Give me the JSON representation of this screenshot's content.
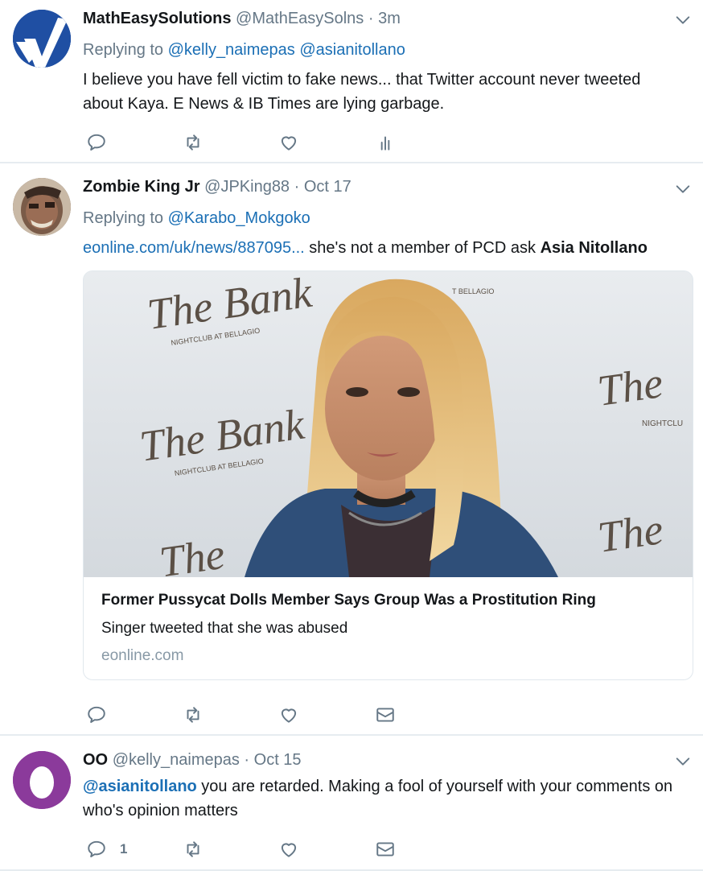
{
  "tweets": [
    {
      "name": "MathEasySolutions",
      "handle": "@MathEasySolns",
      "time": "3m",
      "replying_label": "Replying to",
      "replying_to": [
        "@kelly_naimepas",
        "@asianitollano"
      ],
      "text": "I believe you have fell victim to fake news... that Twitter account never tweeted about Kaya. E News & IB Times are lying garbage.",
      "avatar_icon": "checkmark-logo",
      "actions": [
        "reply-icon",
        "retweet-icon",
        "like-icon",
        "analytics-icon"
      ]
    },
    {
      "name": "Zombie King Jr",
      "handle": "@JPKing88",
      "time": "Oct 17",
      "replying_label": "Replying to",
      "replying_to": [
        "@Karabo_Mokgoko"
      ],
      "link_text": "eonline.com/uk/news/887095...",
      "text_after_link": " she's not a member of PCD ask ",
      "bold_name": "Asia Nitollano",
      "card": {
        "title": "Former Pussycat Dolls Member Says Group Was a Prostitution Ring",
        "description": "Singer tweeted that she was abused",
        "domain": "eonline.com",
        "backdrop_texts": [
          "The Bank",
          "NIGHTCLUB AT BELLAGIO",
          "The Bank",
          "NIGHTCLUB AT BELLAGIO",
          "The",
          "NIGHTCLU",
          "The",
          "The",
          "T BELLAGIO"
        ]
      },
      "actions": [
        "reply-icon",
        "retweet-icon",
        "like-icon",
        "message-icon"
      ]
    },
    {
      "name": "OO",
      "handle": "@kelly_naimepas",
      "time": "Oct 15",
      "mention": "@asianitollano",
      "text": " you are retarded. Making a fool of yourself with your comments on who's opinion matters",
      "reply_count": "1",
      "avatar_icon": "egg-avatar",
      "actions": [
        "reply-icon",
        "retweet-icon",
        "like-icon",
        "message-icon"
      ]
    }
  ],
  "dot": "·",
  "colors": {
    "link": "#1b6fb5",
    "muted": "#657786",
    "avatar_purple": "#8b3a9b",
    "avatar_blue": "#1f4fa3"
  }
}
